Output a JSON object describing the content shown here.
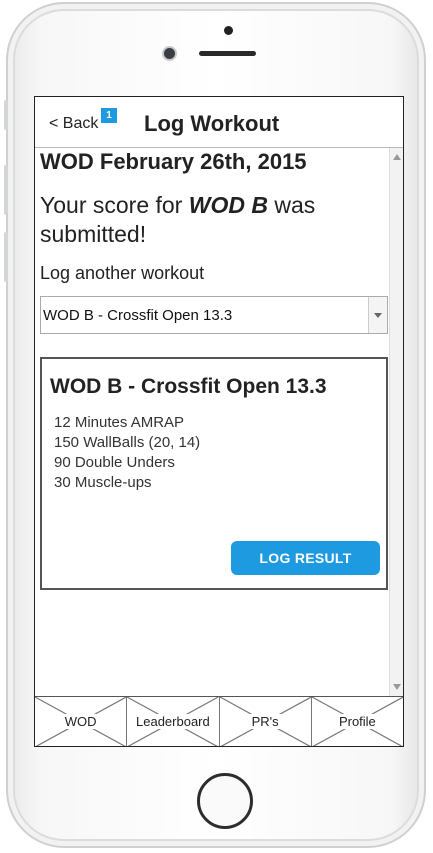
{
  "header": {
    "back_label": "< Back",
    "badge": "1",
    "title": "Log Workout"
  },
  "main": {
    "wod_date": "WOD February 26th, 2015",
    "score_prefix": "Your score for ",
    "score_wod": "WOD B",
    "score_suffix": " was submitted!",
    "log_another": "Log another workout",
    "select_value": "WOD B - Crossfit Open 13.3"
  },
  "card": {
    "title": "WOD B - Crossfit Open 13.3",
    "lines": [
      "12 Minutes AMRAP",
      "150 WallBalls (20, 14)",
      "90 Double Unders",
      "30 Muscle-ups"
    ],
    "button_label": "LOG RESULT"
  },
  "tabs": [
    {
      "label": "WOD"
    },
    {
      "label": "Leaderboard"
    },
    {
      "label": "PR's"
    },
    {
      "label": "Profile"
    }
  ],
  "colors": {
    "accent": "#1e9be0",
    "text": "#222222",
    "border": "#555555"
  },
  "icons": [
    "scroll-up-arrow-icon",
    "scroll-down-arrow-icon",
    "dropdown-arrow-icon",
    "notification-badge"
  ]
}
